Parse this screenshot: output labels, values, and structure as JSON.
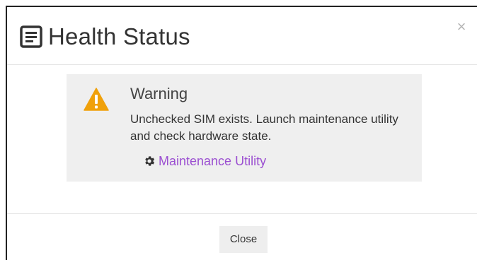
{
  "dialog": {
    "title": "Health Status",
    "title_icon": "document-list-icon",
    "close_icon_glyph": "×"
  },
  "alert": {
    "icon": "warning-triangle-icon",
    "heading": "Warning",
    "message": "Unchecked SIM exists. Launch maintenance utility and check hardware state.",
    "link_icon": "gear-icon",
    "link_label": "Maintenance Utility",
    "link_color": "#9b4fd1",
    "warning_color": "#f0a10a"
  },
  "footer": {
    "close_label": "Close"
  }
}
